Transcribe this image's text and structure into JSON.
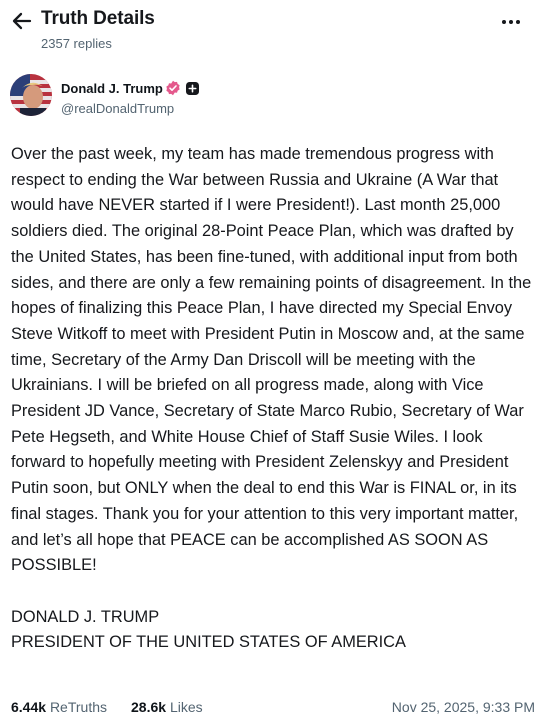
{
  "header": {
    "title": "Truth Details",
    "replies": "2357 replies",
    "back_icon": "arrow-left-icon",
    "more_icon": "ellipsis-icon"
  },
  "author": {
    "name": "Donald J. Trump",
    "handle": "@realDonaldTrump",
    "verified_color": "#e4598c",
    "verified_icon": "verified-badge-icon",
    "extra_badge_icon": "plus-badge-icon"
  },
  "post": {
    "text": "Over the past week, my team has made tremendous progress with respect to ending the War between Russia and Ukraine (A War that would have NEVER started if I were President!). Last month 25,000 soldiers died. The original 28-Point Peace Plan, which was drafted by the United States, has been fine-tuned, with additional input from both sides, and there are only a few remaining points of disagreement. In the hopes of finalizing this Peace Plan, I have directed my Special Envoy Steve Witkoff to meet with President Putin in Moscow and, at the same time, Secretary of the Army Dan Driscoll will be meeting with the Ukrainians. I will be briefed on all progress made, along with Vice President JD Vance, Secretary of State Marco Rubio, Secretary of War Pete Hegseth, and White House Chief of Staff Susie Wiles. I look forward to hopefully meeting with President Zelenskyy and President Putin soon, but ONLY when the deal to end this War is FINAL or, in its final stages. Thank you for your attention to this very important matter, and let’s all hope that PEACE can be accomplished AS SOON AS POSSIBLE!\n\nDONALD J. TRUMP\nPRESIDENT OF THE UNITED STATES OF AMERICA"
  },
  "stats": {
    "retruths_count": "6.44k",
    "retruths_label": "ReTruths",
    "likes_count": "28.6k",
    "likes_label": "Likes",
    "timestamp": "Nov 25, 2025, 9:33 PM"
  }
}
